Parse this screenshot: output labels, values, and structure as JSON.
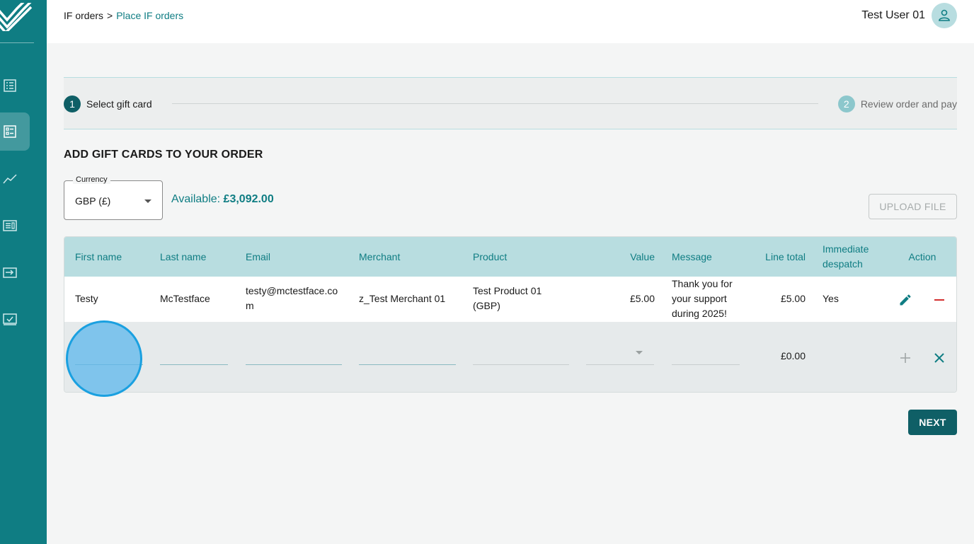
{
  "breadcrumb": {
    "parent": "IF orders",
    "separator": ">",
    "current": "Place IF orders"
  },
  "user": {
    "name": "Test User 01",
    "avatar_icon": "user-icon"
  },
  "sidebar": {
    "items": [
      {
        "icon": "list-icon",
        "active": false
      },
      {
        "icon": "orders-icon",
        "active": true
      },
      {
        "icon": "chart-icon",
        "active": false
      },
      {
        "icon": "report-icon",
        "active": false
      },
      {
        "icon": "transfer-icon",
        "active": false
      },
      {
        "icon": "checklist-icon",
        "active": false
      }
    ]
  },
  "stepper": {
    "steps": [
      {
        "number": "1",
        "label": "Select gift card"
      },
      {
        "number": "2",
        "label": "Review order and pay"
      }
    ]
  },
  "section_title": "ADD GIFT CARDS TO YOUR ORDER",
  "currency": {
    "label": "Currency",
    "value": "GBP (£)"
  },
  "available": {
    "label": "Available:",
    "amount": "£3,092.00"
  },
  "upload_button": "UPLOAD FILE",
  "table": {
    "headers": {
      "first_name": "First name",
      "last_name": "Last name",
      "email": "Email",
      "merchant": "Merchant",
      "product": "Product",
      "value": "Value",
      "message": "Message",
      "line_total": "Line total",
      "immediate_despatch": "Immediate despatch",
      "action": "Action"
    },
    "rows": [
      {
        "first_name": "Testy",
        "last_name": "McTestface",
        "email": "testy@mctestface.com",
        "merchant": "z_Test Merchant 01",
        "product": "Test Product 01 (GBP)",
        "value": "£5.00",
        "message": "Thank you for your support during 2025!",
        "line_total": "£5.00",
        "immediate_despatch": "Yes"
      }
    ],
    "new_row": {
      "line_total": "£0.00"
    }
  },
  "next_button": "NEXT",
  "colors": {
    "primary": "#0f7d83",
    "header_bg": "#b8dde0",
    "danger": "#d32f2f"
  }
}
